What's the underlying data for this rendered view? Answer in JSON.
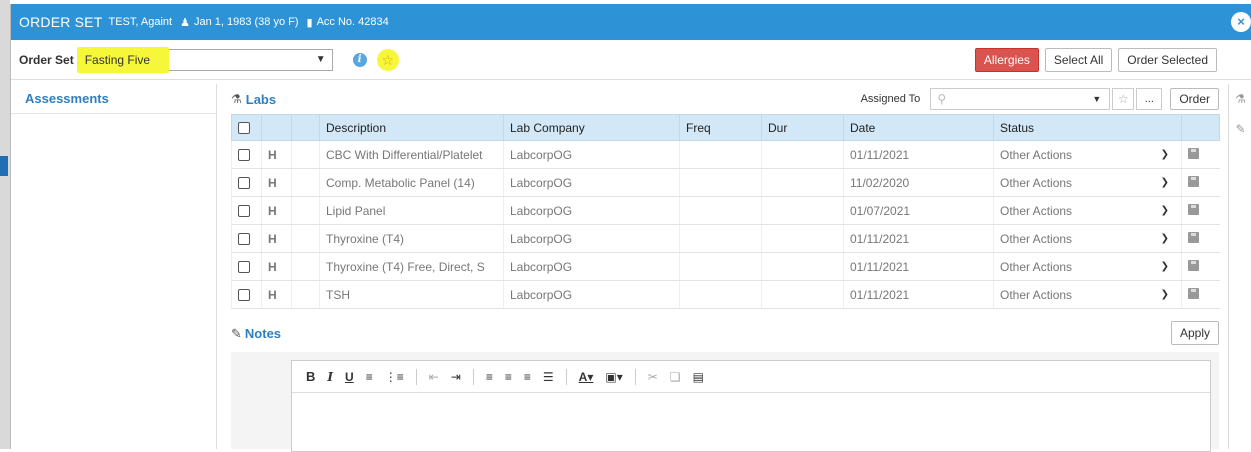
{
  "title": {
    "main": "ORDER SET",
    "patient": "TEST, Againt",
    "dob": "Jan 1, 1983 (38 yo F)",
    "acc": "Acc No. 42834"
  },
  "toolbar": {
    "order_set_label": "Order Set",
    "order_set_value": "Fasting Five",
    "allergies_label": "Allergies",
    "select_all_label": "Select All",
    "order_selected_label": "Order Selected"
  },
  "sidebar": {
    "items": [
      {
        "label": "Assessments"
      }
    ]
  },
  "labs": {
    "title": "Labs",
    "assigned_to_label": "Assigned To",
    "ellipsis_label": "...",
    "order_label": "Order",
    "columns": [
      "Description",
      "Lab Company",
      "Freq",
      "Dur",
      "Date",
      "Status"
    ],
    "rows": [
      {
        "h": "H",
        "description": "CBC With Differential/Platelet",
        "lab": "LabcorpOG",
        "freq": "",
        "dur": "",
        "date": "01/11/2021",
        "status": "Other Actions"
      },
      {
        "h": "H",
        "description": "Comp. Metabolic Panel (14)",
        "lab": "LabcorpOG",
        "freq": "",
        "dur": "",
        "date": "11/02/2020",
        "status": "Other Actions"
      },
      {
        "h": "H",
        "description": "Lipid Panel",
        "lab": "LabcorpOG",
        "freq": "",
        "dur": "",
        "date": "01/07/2021",
        "status": "Other Actions"
      },
      {
        "h": "H",
        "description": "Thyroxine (T4)",
        "lab": "LabcorpOG",
        "freq": "",
        "dur": "",
        "date": "01/11/2021",
        "status": "Other Actions"
      },
      {
        "h": "H",
        "description": "Thyroxine (T4) Free, Direct, S",
        "lab": "LabcorpOG",
        "freq": "",
        "dur": "",
        "date": "01/11/2021",
        "status": "Other Actions"
      },
      {
        "h": "H",
        "description": "TSH",
        "lab": "LabcorpOG",
        "freq": "",
        "dur": "",
        "date": "01/11/2021",
        "status": "Other Actions"
      }
    ]
  },
  "notes": {
    "title": "Notes",
    "apply_label": "Apply"
  },
  "icons": {
    "info": "info-icon",
    "star": "star-icon",
    "flask": "flask-icon",
    "pen": "edit-icon",
    "search": "search-icon",
    "close": "close-icon",
    "save": "save-icon"
  },
  "colors": {
    "titlebar": "#2d93d6",
    "accent": "#2f7fbf",
    "danger": "#d9534f",
    "highlight": "#f7f73a",
    "header_row": "#d2e8f6"
  }
}
